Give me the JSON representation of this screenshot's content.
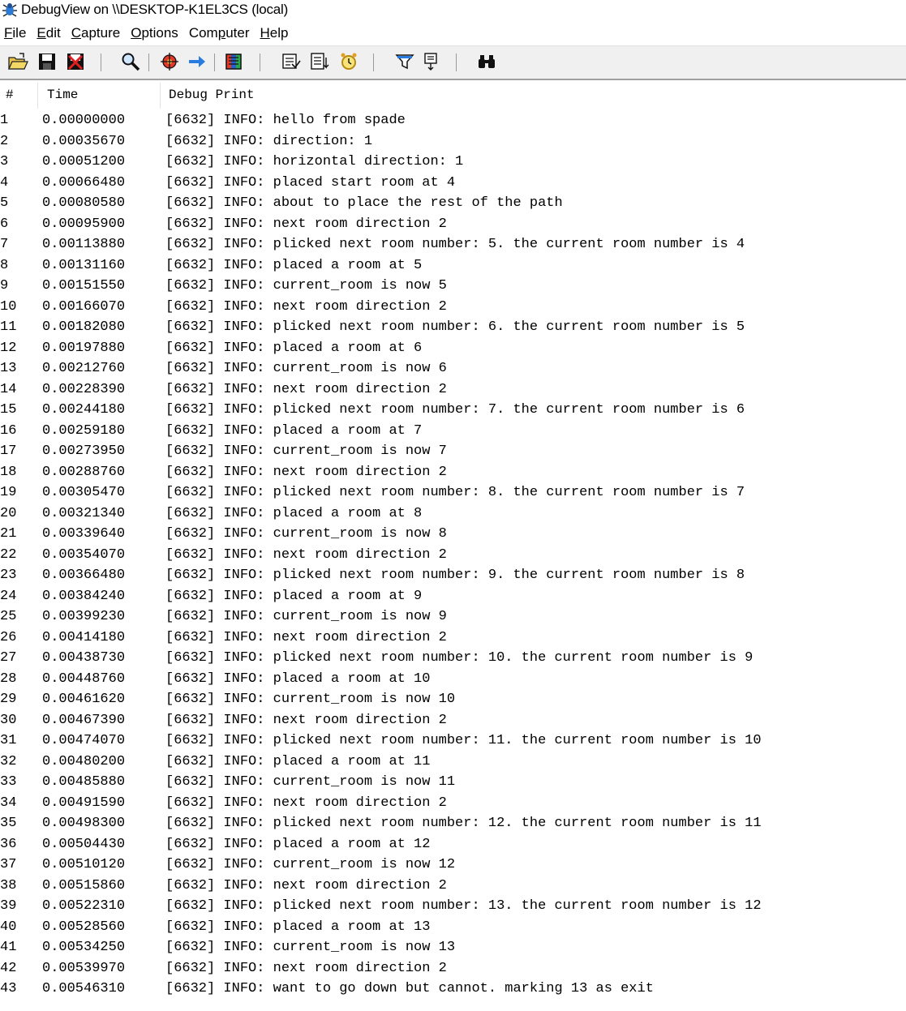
{
  "window": {
    "title": "DebugView on \\\\DESKTOP-K1EL3CS (local)"
  },
  "menu": [
    {
      "mnemonic": "F",
      "rest": "ile"
    },
    {
      "mnemonic": "E",
      "rest": "dit"
    },
    {
      "mnemonic": "C",
      "rest": "apture"
    },
    {
      "mnemonic": "O",
      "rest": "ptions"
    },
    {
      "prefix": "Com",
      "mnemonic": "p",
      "rest": "uter"
    },
    {
      "mnemonic": "H",
      "rest": "elp"
    }
  ],
  "toolbar": {
    "buttons": [
      "open-icon",
      "save-icon",
      "clear-display-icon",
      "find-icon",
      "capture-icon",
      "autoscroll-icon",
      "history-depth-icon",
      "clock-time-icon",
      "elapsed-time-icon",
      "highlight-timer-icon",
      "filter-icon",
      "highlight-icon",
      "binoculars-icon"
    ]
  },
  "columns": {
    "num": "#",
    "time": "Time",
    "print": "Debug Print"
  },
  "colors": {
    "toolbar_bg": "#f0f0f0",
    "text": "#000000",
    "background": "#ffffff"
  },
  "rows": [
    {
      "n": "1",
      "t": "0.00000000",
      "m": "[6632] INFO: hello from spade"
    },
    {
      "n": "2",
      "t": "0.00035670",
      "m": "[6632] INFO: direction: 1"
    },
    {
      "n": "3",
      "t": "0.00051200",
      "m": "[6632] INFO: horizontal direction: 1"
    },
    {
      "n": "4",
      "t": "0.00066480",
      "m": "[6632] INFO: placed start room at 4"
    },
    {
      "n": "5",
      "t": "0.00080580",
      "m": "[6632] INFO: about to place the rest of the path"
    },
    {
      "n": "6",
      "t": "0.00095900",
      "m": "[6632] INFO: next room direction 2"
    },
    {
      "n": "7",
      "t": "0.00113880",
      "m": "[6632] INFO: plicked next room number: 5. the current room number is 4"
    },
    {
      "n": "8",
      "t": "0.00131160",
      "m": "[6632] INFO: placed a room at 5"
    },
    {
      "n": "9",
      "t": "0.00151550",
      "m": "[6632] INFO: current_room is now 5"
    },
    {
      "n": "10",
      "t": "0.00166070",
      "m": "[6632] INFO: next room direction 2"
    },
    {
      "n": "11",
      "t": "0.00182080",
      "m": "[6632] INFO: plicked next room number: 6. the current room number is 5"
    },
    {
      "n": "12",
      "t": "0.00197880",
      "m": "[6632] INFO: placed a room at 6"
    },
    {
      "n": "13",
      "t": "0.00212760",
      "m": "[6632] INFO: current_room is now 6"
    },
    {
      "n": "14",
      "t": "0.00228390",
      "m": "[6632] INFO: next room direction 2"
    },
    {
      "n": "15",
      "t": "0.00244180",
      "m": "[6632] INFO: plicked next room number: 7. the current room number is 6"
    },
    {
      "n": "16",
      "t": "0.00259180",
      "m": "[6632] INFO: placed a room at 7"
    },
    {
      "n": "17",
      "t": "0.00273950",
      "m": "[6632] INFO: current_room is now 7"
    },
    {
      "n": "18",
      "t": "0.00288760",
      "m": "[6632] INFO: next room direction 2"
    },
    {
      "n": "19",
      "t": "0.00305470",
      "m": "[6632] INFO: plicked next room number: 8. the current room number is 7"
    },
    {
      "n": "20",
      "t": "0.00321340",
      "m": "[6632] INFO: placed a room at 8"
    },
    {
      "n": "21",
      "t": "0.00339640",
      "m": "[6632] INFO: current_room is now 8"
    },
    {
      "n": "22",
      "t": "0.00354070",
      "m": "[6632] INFO: next room direction 2"
    },
    {
      "n": "23",
      "t": "0.00366480",
      "m": "[6632] INFO: plicked next room number: 9. the current room number is 8"
    },
    {
      "n": "24",
      "t": "0.00384240",
      "m": "[6632] INFO: placed a room at 9"
    },
    {
      "n": "25",
      "t": "0.00399230",
      "m": "[6632] INFO: current_room is now 9"
    },
    {
      "n": "26",
      "t": "0.00414180",
      "m": "[6632] INFO: next room direction 2"
    },
    {
      "n": "27",
      "t": "0.00438730",
      "m": "[6632] INFO: plicked next room number: 10. the current room number is 9"
    },
    {
      "n": "28",
      "t": "0.00448760",
      "m": "[6632] INFO: placed a room at 10"
    },
    {
      "n": "29",
      "t": "0.00461620",
      "m": "[6632] INFO: current_room is now 10"
    },
    {
      "n": "30",
      "t": "0.00467390",
      "m": "[6632] INFO: next room direction 2"
    },
    {
      "n": "31",
      "t": "0.00474070",
      "m": "[6632] INFO: plicked next room number: 11. the current room number is 10"
    },
    {
      "n": "32",
      "t": "0.00480200",
      "m": "[6632] INFO: placed a room at 11"
    },
    {
      "n": "33",
      "t": "0.00485880",
      "m": "[6632] INFO: current_room is now 11"
    },
    {
      "n": "34",
      "t": "0.00491590",
      "m": "[6632] INFO: next room direction 2"
    },
    {
      "n": "35",
      "t": "0.00498300",
      "m": "[6632] INFO: plicked next room number: 12. the current room number is 11"
    },
    {
      "n": "36",
      "t": "0.00504430",
      "m": "[6632] INFO: placed a room at 12"
    },
    {
      "n": "37",
      "t": "0.00510120",
      "m": "[6632] INFO: current_room is now 12"
    },
    {
      "n": "38",
      "t": "0.00515860",
      "m": "[6632] INFO: next room direction 2"
    },
    {
      "n": "39",
      "t": "0.00522310",
      "m": "[6632] INFO: plicked next room number: 13. the current room number is 12"
    },
    {
      "n": "40",
      "t": "0.00528560",
      "m": "[6632] INFO: placed a room at 13"
    },
    {
      "n": "41",
      "t": "0.00534250",
      "m": "[6632] INFO: current_room is now 13"
    },
    {
      "n": "42",
      "t": "0.00539970",
      "m": "[6632] INFO: next room direction 2"
    },
    {
      "n": "43",
      "t": "0.00546310",
      "m": "[6632] INFO: want to go down but cannot. marking 13 as exit"
    }
  ]
}
